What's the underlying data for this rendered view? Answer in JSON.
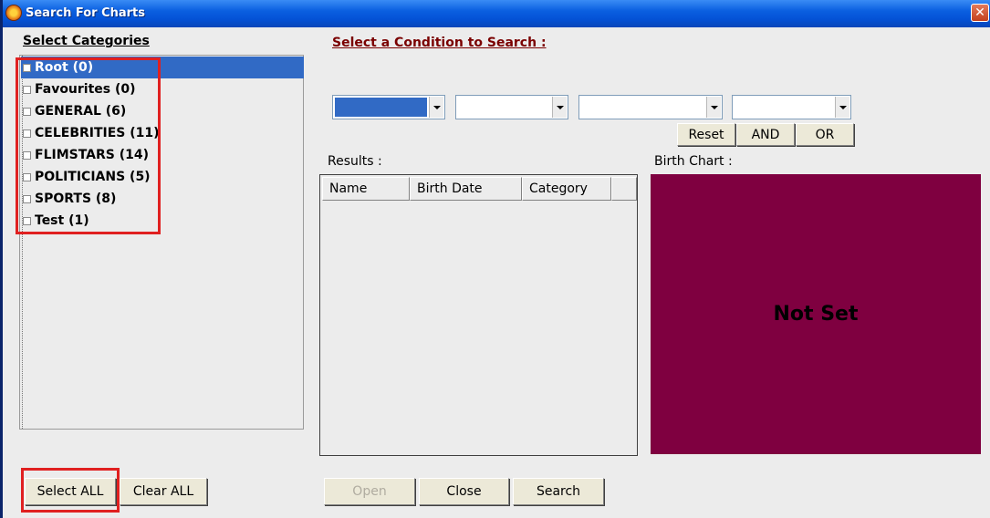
{
  "window": {
    "title": "Search For Charts",
    "close_glyph": "✕"
  },
  "categories": {
    "label": "Select Categories",
    "items": [
      {
        "label": "Root (0)",
        "selected": true
      },
      {
        "label": "Favourites (0)"
      },
      {
        "label": "GENERAL (6)"
      },
      {
        "label": "CELEBRITIES (11)"
      },
      {
        "label": "FLIMSTARS (14)"
      },
      {
        "label": "POLITICIANS (5)"
      },
      {
        "label": "SPORTS (8)"
      },
      {
        "label": "Test (1)"
      }
    ],
    "select_all": "Select ALL",
    "clear_all": "Clear ALL"
  },
  "condition": {
    "label": "Select a Condition to Search :",
    "combos": [
      "",
      "",
      "",
      ""
    ],
    "reset": "Reset",
    "and": "AND",
    "or": "OR"
  },
  "results": {
    "label": "Results :",
    "columns": [
      "Name",
      "Birth Date",
      "Category",
      ""
    ]
  },
  "birth_chart": {
    "label": "Birth Chart :",
    "status": "Not Set",
    "color": "#7f0040"
  },
  "footer": {
    "open": "Open",
    "close": "Close",
    "search": "Search"
  },
  "colors": {
    "title_bar": "#0452d6",
    "selection": "#316ac5",
    "highlight_box": "#e02020",
    "condition_label": "#7a0000"
  }
}
